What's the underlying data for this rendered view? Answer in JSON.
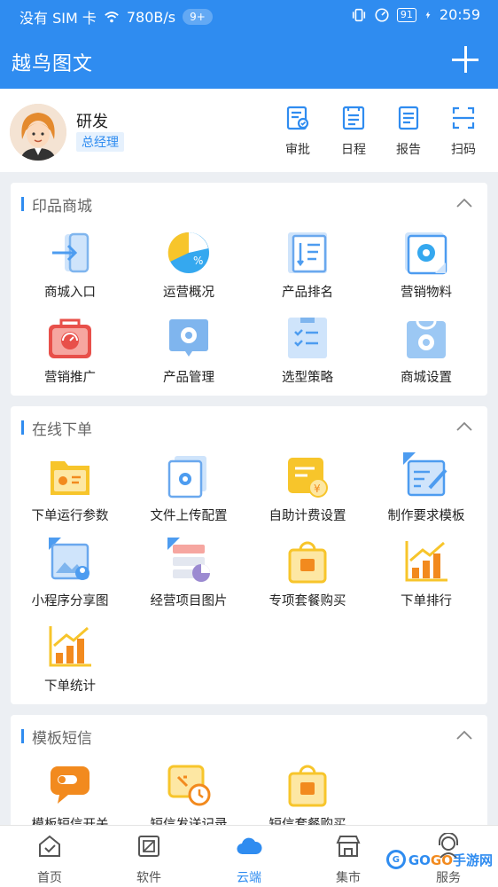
{
  "status_bar": {
    "carrier": "没有 SIM 卡",
    "speed": "780B/s",
    "notif_badge": "9+",
    "battery": "91",
    "time": "20:59"
  },
  "header": {
    "title": "越鸟图文"
  },
  "profile": {
    "name": "研发",
    "role": "总经理",
    "actions": [
      {
        "label": "审批",
        "icon": "approval-icon"
      },
      {
        "label": "日程",
        "icon": "schedule-icon"
      },
      {
        "label": "报告",
        "icon": "report-icon"
      },
      {
        "label": "扫码",
        "icon": "scan-icon"
      }
    ]
  },
  "sections": [
    {
      "title": "印品商城",
      "items": [
        {
          "label": "商城入口",
          "icon": "mall-entry-icon"
        },
        {
          "label": "运营概况",
          "icon": "operations-overview-icon"
        },
        {
          "label": "产品排名",
          "icon": "product-ranking-icon"
        },
        {
          "label": "营销物料",
          "icon": "marketing-materials-icon"
        },
        {
          "label": "营销推广",
          "icon": "marketing-promotion-icon"
        },
        {
          "label": "产品管理",
          "icon": "product-management-icon"
        },
        {
          "label": "选型策略",
          "icon": "selection-strategy-icon"
        },
        {
          "label": "商城设置",
          "icon": "mall-settings-icon"
        }
      ]
    },
    {
      "title": "在线下单",
      "items": [
        {
          "label": "下单运行参数",
          "icon": "order-params-icon"
        },
        {
          "label": "文件上传配置",
          "icon": "file-upload-config-icon"
        },
        {
          "label": "自助计费设置",
          "icon": "self-billing-icon"
        },
        {
          "label": "制作要求模板",
          "icon": "requirement-template-icon"
        },
        {
          "label": "小程序分享图",
          "icon": "miniprogram-share-icon"
        },
        {
          "label": "经营项目图片",
          "icon": "business-images-icon"
        },
        {
          "label": "专项套餐购买",
          "icon": "package-purchase-icon"
        },
        {
          "label": "下单排行",
          "icon": "order-ranking-icon"
        },
        {
          "label": "下单统计",
          "icon": "order-stats-icon"
        }
      ]
    },
    {
      "title": "模板短信",
      "items": [
        {
          "label": "模板短信开关",
          "icon": "sms-toggle-icon"
        },
        {
          "label": "短信发送记录",
          "icon": "sms-records-icon"
        },
        {
          "label": "短信套餐购买",
          "icon": "sms-package-icon"
        }
      ]
    }
  ],
  "tabbar": {
    "active": "云端",
    "tabs": [
      {
        "label": "首页",
        "icon": "home-icon"
      },
      {
        "label": "软件",
        "icon": "software-icon"
      },
      {
        "label": "云端",
        "icon": "cloud-icon"
      },
      {
        "label": "集市",
        "icon": "market-icon"
      },
      {
        "label": "服务",
        "icon": "service-icon"
      }
    ]
  },
  "watermark": {
    "text_a": "GO",
    "text_b": "GO",
    "text_c": "手游网"
  },
  "colors": {
    "accent": "#2f8cf0",
    "yellow": "#f7c52b",
    "red": "#e8504a",
    "orange": "#f28a1e"
  }
}
